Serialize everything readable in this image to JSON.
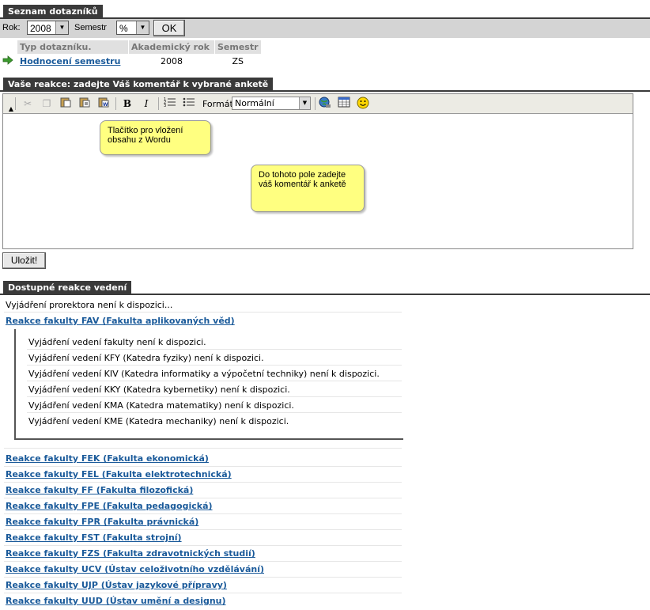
{
  "section1": {
    "title": "Seznam dotazníků"
  },
  "filter": {
    "year_label": "Rok:",
    "year_value": "2008",
    "semester_label": "Semestr",
    "semester_value": "%",
    "ok_label": "OK"
  },
  "table": {
    "headers": [
      "Typ dotazníku.",
      "Akademický rok",
      "Semestr"
    ],
    "rows": [
      {
        "type": "Hodnocení semestru",
        "year": "2008",
        "semester": "ZS"
      }
    ]
  },
  "section2": {
    "title": "Vaše reakce: zadejte Váš komentář k vybrané anketě"
  },
  "editor": {
    "format_label": "Formát",
    "format_value": "Normální",
    "tooltip_word": "Tlačítko pro vložení obsahu z Wordu",
    "tooltip_field": "Do tohoto pole zadejte váš komentář k anketě"
  },
  "save_label": "Uložit!",
  "section3": {
    "title": "Dostupné reakce vedení"
  },
  "prorector_text": "Vyjádření prorektora není k dispozici...",
  "fav": {
    "link": "Reakce fakulty FAV (Fakulta aplikovaných věd)",
    "items": [
      "Vyjádření vedení fakulty není k dispozici.",
      "Vyjádření vedení KFY (Katedra fyziky) není k dispozici.",
      "Vyjádření vedení KIV (Katedra informatiky a výpočetní techniky) není k dispozici.",
      "Vyjádření vedení KKY (Katedra kybernetiky) není k dispozici.",
      "Vyjádření vedení KMA (Katedra matematiky) není k dispozici.",
      "Vyjádření vedení KME (Katedra mechaniky) není k dispozici."
    ]
  },
  "faculty_links": [
    "Reakce fakulty FEK (Fakulta ekonomická)",
    "Reakce fakulty FEL (Fakulta elektrotechnická)",
    "Reakce fakulty FF (Fakulta filozofická)",
    "Reakce fakulty FPE (Fakulta pedagogická)",
    "Reakce fakulty FPR (Fakulta právnická)",
    "Reakce fakulty FST (Fakulta strojní)",
    "Reakce fakulty FZS (Fakulta zdravotnických studií)",
    "Reakce fakulty UCV (Ústav celoživotního vzdělávání)",
    "Reakce fakulty UJP (Ústav jazykové přípravy)",
    "Reakce fakulty UUD (Ústav umění a designu)"
  ],
  "colors": {
    "header_bg": "#3a3a3a",
    "link": "#1a5a9a",
    "callout": "#ffff80"
  }
}
